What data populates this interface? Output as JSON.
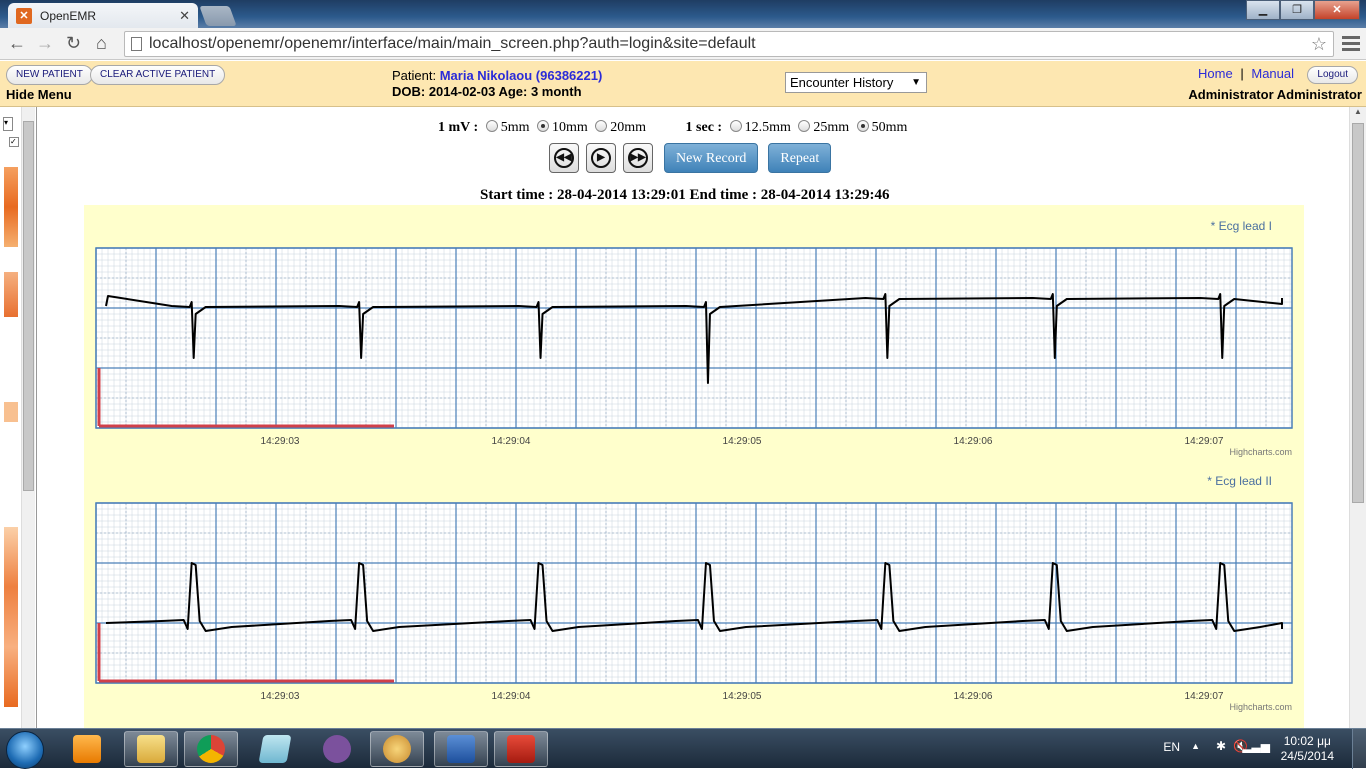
{
  "browser": {
    "tab_title": "OpenEMR",
    "tab_close": "✕",
    "url": "localhost/openemr/openemr/interface/main/main_screen.php?auth=login&site=default"
  },
  "header": {
    "new_patient": "NEW PATIENT",
    "clear_active_patient": "CLEAR ACTIVE PATIENT",
    "hide_menu": "Hide Menu",
    "patient_label": "Patient:",
    "patient_name": "Maria Nikolaou (96386221)",
    "dob_line": "DOB: 2014-02-03 Age: 3 month",
    "encounter_select": "Encounter History",
    "home": "Home",
    "separator": "|",
    "manual": "Manual",
    "logout": "Logout",
    "user": "Administrator Administrator"
  },
  "ecg": {
    "mv_label": "1 mV :",
    "mv_options": [
      "5mm",
      "10mm",
      "20mm"
    ],
    "mv_selected": "10mm",
    "sec_label": "1 sec :",
    "sec_options": [
      "12.5mm",
      "25mm",
      "50mm"
    ],
    "sec_selected": "50mm",
    "new_record": "New Record",
    "repeat": "Repeat",
    "time_range": "Start time : 28-04-2014 13:29:01 End time : 28-04-2014 13:29:46"
  },
  "chart_data": [
    {
      "type": "line",
      "series": [
        {
          "name": "Ecg lead I"
        }
      ],
      "legend": "* Ecg lead I",
      "x_ticks": [
        "14:29:03",
        "14:29:04",
        "14:29:05",
        "14:29:06",
        "14:29:07"
      ],
      "credit": "Highcharts.com",
      "legend_position": "top-right",
      "grid": true,
      "beats_at": [
        0.08,
        0.22,
        0.37,
        0.51,
        0.66,
        0.8,
        0.94
      ]
    },
    {
      "type": "line",
      "series": [
        {
          "name": "Ecg lead II"
        }
      ],
      "legend": "* Ecg lead II",
      "x_ticks": [
        "14:29:03",
        "14:29:04",
        "14:29:05",
        "14:29:06",
        "14:29:07"
      ],
      "credit": "Highcharts.com",
      "legend_position": "top-right",
      "grid": true
    }
  ],
  "taskbar": {
    "language": "EN",
    "time": "10:02 μμ",
    "date": "24/5/2014"
  },
  "colors": {
    "header_bg": "#fde7b1",
    "chart_bg": "#ffffcc",
    "grid_major": "#4a7fb8",
    "calibration": "#d0404a"
  }
}
